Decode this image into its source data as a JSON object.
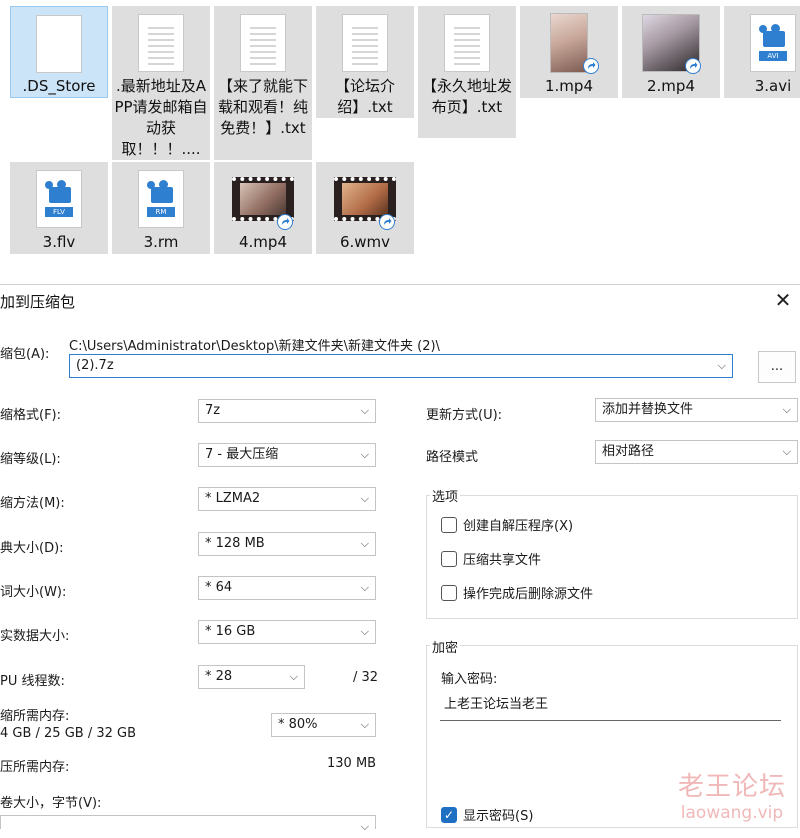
{
  "files": [
    {
      "name": ".DS_Store",
      "kind": "blank",
      "selected": true
    },
    {
      "name": ".最新地址及APP请发邮箱自动获取！！！....",
      "kind": "doc"
    },
    {
      "name": "【来了就能下载和观看！纯免费！】.txt",
      "kind": "doc"
    },
    {
      "name": "【论坛介绍】.txt",
      "kind": "doc"
    },
    {
      "name": "【永久地址发布页】.txt",
      "kind": "doc"
    },
    {
      "name": "1.mp4",
      "kind": "photo"
    },
    {
      "name": "2.mp4",
      "kind": "photo"
    },
    {
      "name": "3.avi",
      "kind": "media",
      "ext": "AVI"
    },
    {
      "name": "3.flv",
      "kind": "media",
      "ext": "FLV"
    },
    {
      "name": "3.rm",
      "kind": "media",
      "ext": "RM"
    },
    {
      "name": "4.mp4",
      "kind": "video"
    },
    {
      "name": "6.wmv",
      "kind": "video"
    }
  ],
  "dialog": {
    "title": "加到压缩包",
    "archive_label": "缩包(A):",
    "path": "C:\\Users\\Administrator\\Desktop\\新建文件夹\\新建文件夹 (2)\\",
    "archive_name": "(2).7z",
    "browse_label": "...",
    "left": [
      {
        "label": "缩格式(F):",
        "value": "7z"
      },
      {
        "label": "缩等级(L):",
        "value": "7 - 最大压缩"
      },
      {
        "label": "缩方法(M):",
        "value": "*  LZMA2"
      },
      {
        "label": "典大小(D):",
        "value": "*  128 MB"
      },
      {
        "label": "词大小(W):",
        "value": "*  64"
      },
      {
        "label": "实数据大小:",
        "value": "*  16 GB"
      }
    ],
    "threads_label": "PU 线程数:",
    "threads_value": "*  28",
    "threads_max": "/ 32",
    "mem_label": "缩所需内存:",
    "mem_values": "4 GB / 25 GB / 32 GB",
    "mem_percent": "*  80%",
    "decomp_label": "压所需内存:",
    "decomp_value": "130 MB",
    "volume_label": "卷大小，字节(V):",
    "update_label": "更新方式(U):",
    "update_value": "添加并替换文件",
    "pathmode_label": "路径模式",
    "pathmode_value": "相对路径",
    "options_title": "选项",
    "options": [
      {
        "label": "创建自解压程序(X)",
        "checked": false
      },
      {
        "label": "压缩共享文件",
        "checked": false
      },
      {
        "label": "操作完成后删除源文件",
        "checked": false
      }
    ],
    "encrypt_title": "加密",
    "password_label": "输入密码:",
    "password_value": "上老王论坛当老王",
    "show_password_label": "显示密码(S)",
    "show_password_checked": true
  },
  "watermark": {
    "main": "老王论坛",
    "sub": "laowang.vip"
  },
  "colors": {
    "selected_tile": "#cce4f7",
    "tile": "#dedede",
    "accent": "#1f6fc2",
    "watermark": "#f0b8b8"
  }
}
